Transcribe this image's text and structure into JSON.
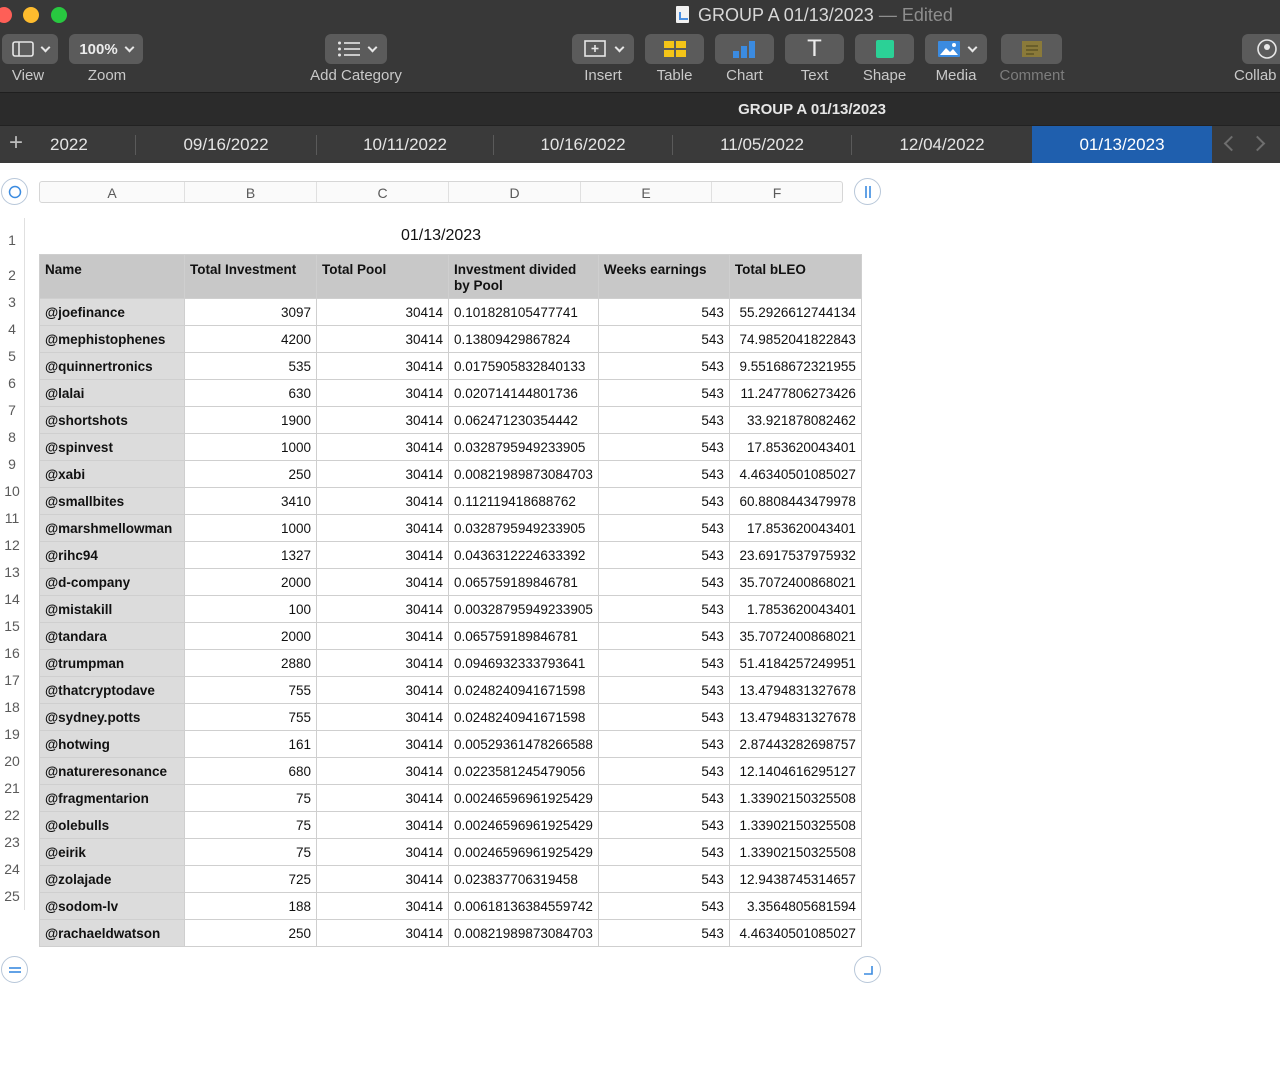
{
  "window": {
    "title": "GROUP A 01/13/2023",
    "title_suffix": "— Edited"
  },
  "toolbar": {
    "view_label": "View",
    "zoom_value": "100%",
    "zoom_label": "Zoom",
    "add_category_label": "Add Category",
    "insert_label": "Insert",
    "table_label": "Table",
    "chart_label": "Chart",
    "text_label": "Text",
    "text_icon_glyph": "T",
    "shape_label": "Shape",
    "media_label": "Media",
    "comment_label": "Comment",
    "collab_label": "Collab"
  },
  "sheet": {
    "name": "GROUP A 01/13/2023",
    "tabs": [
      "2022",
      "09/16/2022",
      "10/11/2022",
      "10/16/2022",
      "11/05/2022",
      "12/04/2022",
      "01/13/2023"
    ],
    "active_tab": "01/13/2023"
  },
  "columns": [
    "A",
    "B",
    "C",
    "D",
    "E",
    "F"
  ],
  "table": {
    "title": "01/13/2023",
    "headers": [
      "Name",
      "Total Investment",
      "Total Pool",
      "Investment divided by Pool",
      "Weeks earnings",
      "Total bLEO"
    ],
    "rows": [
      [
        "@joefinance",
        "3097",
        "30414",
        "0.101828105477741",
        "543",
        "55.2926612744134"
      ],
      [
        "@mephistophenes",
        "4200",
        "30414",
        "0.13809429867824",
        "543",
        "74.9852041822843"
      ],
      [
        "@quinnertronics",
        "535",
        "30414",
        "0.0175905832840133",
        "543",
        "9.55168672321955"
      ],
      [
        "@lalai",
        "630",
        "30414",
        "0.020714144801736",
        "543",
        "11.2477806273426"
      ],
      [
        "@shortshots",
        "1900",
        "30414",
        "0.062471230354442",
        "543",
        "33.921878082462"
      ],
      [
        "@spinvest",
        "1000",
        "30414",
        "0.0328795949233905",
        "543",
        "17.853620043401"
      ],
      [
        "@xabi",
        "250",
        "30414",
        "0.00821989873084703",
        "543",
        "4.46340501085027"
      ],
      [
        "@smallbites",
        "3410",
        "30414",
        "0.112119418688762",
        "543",
        "60.8808443479978"
      ],
      [
        "@marshmellowman",
        "1000",
        "30414",
        "0.0328795949233905",
        "543",
        "17.853620043401"
      ],
      [
        "@rihc94",
        "1327",
        "30414",
        "0.0436312224633392",
        "543",
        "23.6917537975932"
      ],
      [
        "@d-company",
        "2000",
        "30414",
        "0.065759189846781",
        "543",
        "35.7072400868021"
      ],
      [
        "@mistakill",
        "100",
        "30414",
        "0.00328795949233905",
        "543",
        "1.7853620043401"
      ],
      [
        "@tandara",
        "2000",
        "30414",
        "0.065759189846781",
        "543",
        "35.7072400868021"
      ],
      [
        "@trumpman",
        "2880",
        "30414",
        "0.0946932333793641",
        "543",
        "51.4184257249951"
      ],
      [
        "@thatcryptodave",
        "755",
        "30414",
        "0.0248240941671598",
        "543",
        "13.4794831327678"
      ],
      [
        "@sydney.potts",
        "755",
        "30414",
        "0.0248240941671598",
        "543",
        "13.4794831327678"
      ],
      [
        "@hotwing",
        "161",
        "30414",
        "0.00529361478266588",
        "543",
        "2.87443282698757"
      ],
      [
        "@natureresonance",
        "680",
        "30414",
        "0.0223581245479056",
        "543",
        "12.1404616295127"
      ],
      [
        "@fragmentarion",
        "75",
        "30414",
        "0.00246596961925429",
        "543",
        "1.33902150325508"
      ],
      [
        "@olebulls",
        "75",
        "30414",
        "0.00246596961925429",
        "543",
        "1.33902150325508"
      ],
      [
        "@eirik",
        "75",
        "30414",
        "0.00246596961925429",
        "543",
        "1.33902150325508"
      ],
      [
        "@zolajade",
        "725",
        "30414",
        "0.023837706319458",
        "543",
        "12.9438745314657"
      ],
      [
        "@sodom-lv",
        "188",
        "30414",
        "0.00618136384559742",
        "543",
        "3.3564805681594"
      ],
      [
        "@rachaeldwatson",
        "250",
        "30414",
        "0.00821989873084703",
        "543",
        "4.46340501085027"
      ]
    ]
  },
  "icons": {
    "view": "sidebar-view-icon",
    "add_category": "list-icon",
    "insert": "insert-icon",
    "table": "table-icon",
    "chart": "chart-icon",
    "text": "text-icon",
    "shape": "shape-icon",
    "media": "media-icon",
    "comment": "comment-icon",
    "collab": "collaborate-icon"
  }
}
